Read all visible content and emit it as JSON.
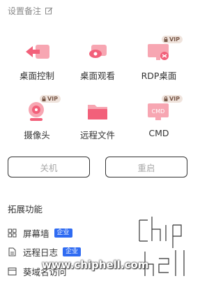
{
  "remark": {
    "label": "设置备注",
    "icon": "edit-icon"
  },
  "tiles": [
    {
      "label": "桌面控制",
      "icon": "desktop-control-icon",
      "vip": false
    },
    {
      "label": "桌面观看",
      "icon": "desktop-view-icon",
      "vip": false
    },
    {
      "label": "RDP桌面",
      "icon": "rdp-desktop-icon",
      "vip": true
    },
    {
      "label": "摄像头",
      "icon": "camera-icon",
      "vip": true
    },
    {
      "label": "远程文件",
      "icon": "folder-icon",
      "vip": false
    },
    {
      "label": "CMD",
      "icon": "cmd-icon",
      "vip": true
    }
  ],
  "vip_label": "VIP",
  "cmd_glyph": "CMD",
  "buttons": {
    "shutdown": "关机",
    "restart": "重启"
  },
  "extensions": {
    "title": "拓展功能",
    "items": [
      {
        "label": "屏幕墙",
        "badge": "企业",
        "icon": "grid-icon"
      },
      {
        "label": "远程日志",
        "badge": "企业",
        "icon": "document-icon"
      },
      {
        "label": "葵域名访问",
        "badge": "",
        "icon": "browser-icon"
      }
    ]
  },
  "watermark": {
    "text": "www.chiphell.com",
    "logo_text": "chip hell"
  },
  "colors": {
    "accent_pink": "#f2607a",
    "light_pink": "#f7a6b2",
    "badge_blue": "#2f6bf2",
    "vip_bg": "#efe3dc"
  }
}
